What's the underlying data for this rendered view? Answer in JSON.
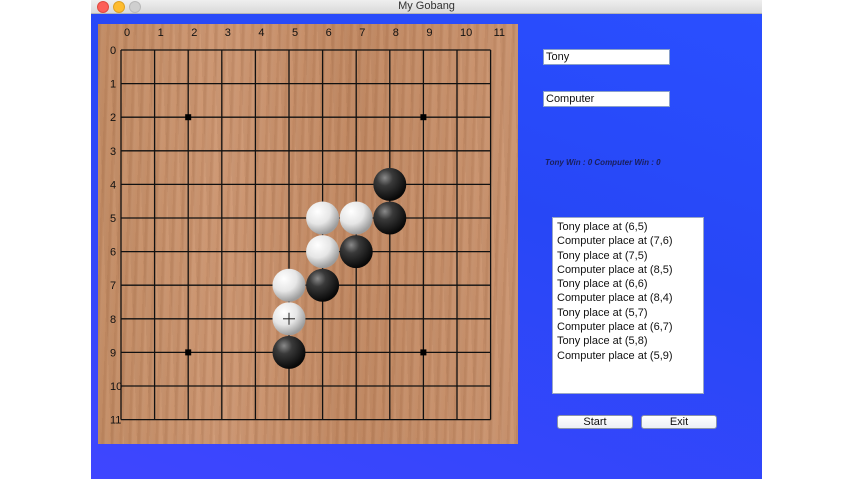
{
  "window": {
    "title": "My Gobang"
  },
  "board": {
    "size": 12,
    "coord_labels": [
      "0",
      "1",
      "2",
      "3",
      "4",
      "5",
      "6",
      "7",
      "8",
      "9",
      "10",
      "11"
    ],
    "star_points": [
      [
        2,
        2
      ],
      [
        9,
        2
      ],
      [
        2,
        9
      ],
      [
        9,
        9
      ]
    ],
    "stones": [
      {
        "col": 8,
        "row": 4,
        "color": "black"
      },
      {
        "col": 8,
        "row": 5,
        "color": "black"
      },
      {
        "col": 6,
        "row": 5,
        "color": "white"
      },
      {
        "col": 7,
        "row": 5,
        "color": "white"
      },
      {
        "col": 6,
        "row": 6,
        "color": "white"
      },
      {
        "col": 7,
        "row": 6,
        "color": "black"
      },
      {
        "col": 5,
        "row": 7,
        "color": "white"
      },
      {
        "col": 6,
        "row": 7,
        "color": "black"
      },
      {
        "col": 5,
        "row": 8,
        "color": "white"
      },
      {
        "col": 5,
        "row": 9,
        "color": "black"
      }
    ]
  },
  "fields": {
    "player_name": "Tony",
    "computer_name": "Computer"
  },
  "score_text": "Tony Win : 0   Computer Win : 0",
  "log": [
    "Tony place at (6,5)",
    "Computer place at (7,6)",
    "Tony place at (7,5)",
    "Computer place at (8,5)",
    "Tony place at (6,6)",
    "Computer place at (8,4)",
    "Tony place at (5,7)",
    "Computer place at (6,7)",
    "Tony place at (5,8)",
    "Computer place at (5,9)"
  ],
  "buttons": {
    "start": "Start",
    "exit": "Exit"
  },
  "icons": {
    "cursor": "crosshair-cursor-icon"
  }
}
